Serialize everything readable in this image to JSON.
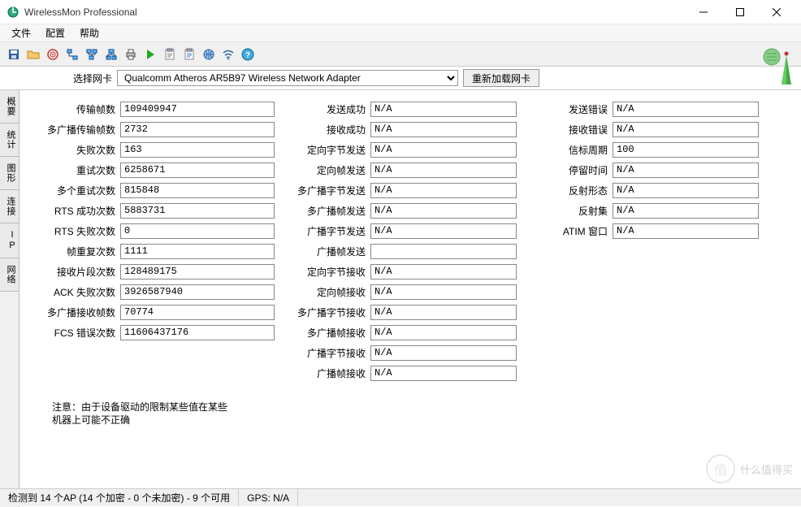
{
  "window": {
    "title": "WirelessMon Professional"
  },
  "menu": {
    "file": "文件",
    "config": "配置",
    "help": "帮助"
  },
  "toolbar_icons": {
    "save": "save-icon",
    "open": "open-icon",
    "target": "target-icon",
    "net1": "net-icon",
    "net2": "net-icon",
    "net3": "net-icon",
    "printer": "printer-icon",
    "play": "play-icon",
    "clipboard1": "clipboard-icon",
    "clipboard2": "clipboard-icon",
    "globe": "globe-icon",
    "wifi": "wifi-icon",
    "helpq": "help-icon"
  },
  "adapter": {
    "label": "选择网卡",
    "selected": "Qualcomm Atheros AR5B97 Wireless Network Adapter",
    "reload_btn": "重新加载网卡"
  },
  "vtabs": [
    "概要",
    "统计",
    "图形",
    "连接",
    "IP",
    "网络"
  ],
  "stats": {
    "col1": [
      {
        "label": "传输帧数",
        "value": "109409947"
      },
      {
        "label": "多广播传输帧数",
        "value": "2732"
      },
      {
        "label": "失败次数",
        "value": "163"
      },
      {
        "label": "重试次数",
        "value": "6258671"
      },
      {
        "label": "多个重试次数",
        "value": "815848"
      },
      {
        "label": "RTS 成功次数",
        "value": "5883731"
      },
      {
        "label": "RTS 失败次数",
        "value": "0"
      },
      {
        "label": "帧重复次数",
        "value": "1111"
      },
      {
        "label": "接收片段次数",
        "value": "128489175"
      },
      {
        "label": "ACK 失败次数",
        "value": "3926587940"
      },
      {
        "label": "多广播接收帧数",
        "value": "70774"
      },
      {
        "label": "FCS 错误次数",
        "value": "11606437176"
      }
    ],
    "col2": [
      {
        "label": "发送成功",
        "value": "N/A"
      },
      {
        "label": "接收成功",
        "value": "N/A"
      },
      {
        "label": "定向字节发送",
        "value": "N/A"
      },
      {
        "label": "定向帧发送",
        "value": "N/A"
      },
      {
        "label": "多广播字节发送",
        "value": "N/A"
      },
      {
        "label": "多广播帧发送",
        "value": "N/A"
      },
      {
        "label": "广播字节发送",
        "value": "N/A"
      },
      {
        "label": "广播帧发送",
        "value": ""
      },
      {
        "label": "定向字节接收",
        "value": "N/A"
      },
      {
        "label": "定向帧接收",
        "value": "N/A"
      },
      {
        "label": "多广播字节接收",
        "value": "N/A"
      },
      {
        "label": "多广播帧接收",
        "value": "N/A"
      },
      {
        "label": "广播字节接收",
        "value": "N/A"
      },
      {
        "label": "广播帧接收",
        "value": "N/A"
      }
    ],
    "col3": [
      {
        "label": "发送错误",
        "value": "N/A"
      },
      {
        "label": "接收错误",
        "value": "N/A"
      },
      {
        "label": "信标周期",
        "value": "100"
      },
      {
        "label": "停留时间",
        "value": "N/A"
      },
      {
        "label": "反射形态",
        "value": "N/A"
      },
      {
        "label": "反射集",
        "value": "N/A"
      },
      {
        "label": "ATIM 窗口",
        "value": "N/A"
      }
    ]
  },
  "note": "注意：由于设备驱动的限制某些值在某些机器上可能不正确",
  "status": {
    "ap": "检测到 14 个AP (14 个加密 - 0 个未加密) - 9 个可用",
    "gps": "GPS: N/A"
  },
  "watermark": "什么值得买"
}
